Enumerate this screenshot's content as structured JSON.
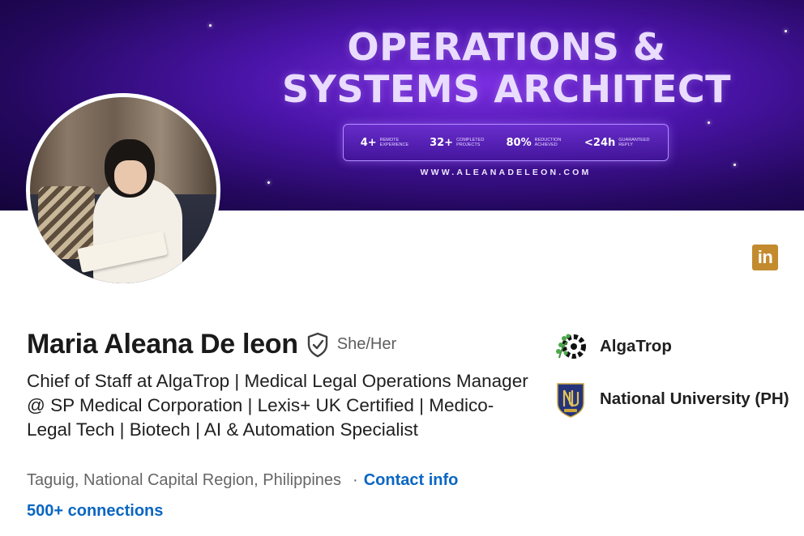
{
  "banner": {
    "title_line1": "OPERATIONS &",
    "title_line2": "SYSTEMS ARCHITECT",
    "stats": [
      {
        "value": "4+",
        "caption": "Remote Experience"
      },
      {
        "value": "32+",
        "caption": "Completed Projects"
      },
      {
        "value": "80%",
        "caption": "Reduction Achieved"
      },
      {
        "value": "<24h",
        "caption": "Guaranteed Reply"
      }
    ],
    "url": "WWW.ALEANADELEON.COM"
  },
  "profile": {
    "avatar_icon": "profile-photo",
    "name": "Maria Aleana De leon",
    "verified_icon": "verified-shield-icon",
    "pronouns": "She/Her",
    "headline": "Chief of Staff at AlgaTrop | Medical Legal Operations Manager @ SP Medical Corporation | Lexis+ UK Certified | Medico-Legal Tech | Biotech | AI & Automation Specialist",
    "location": "Taguig, National Capital Region, Philippines",
    "separator": "·",
    "contact_info_label": "Contact info",
    "connections_label": "500+ connections"
  },
  "social": {
    "linkedin_label": "in",
    "linkedin_color": "#c38b2e"
  },
  "organizations": [
    {
      "name": "AlgaTrop",
      "logo_icon": "algatrop-logo"
    },
    {
      "name": "National University (PH)",
      "logo_icon": "national-university-logo"
    }
  ],
  "colors": {
    "link": "#0a66c2",
    "banner_primary": "#4a14a8"
  }
}
